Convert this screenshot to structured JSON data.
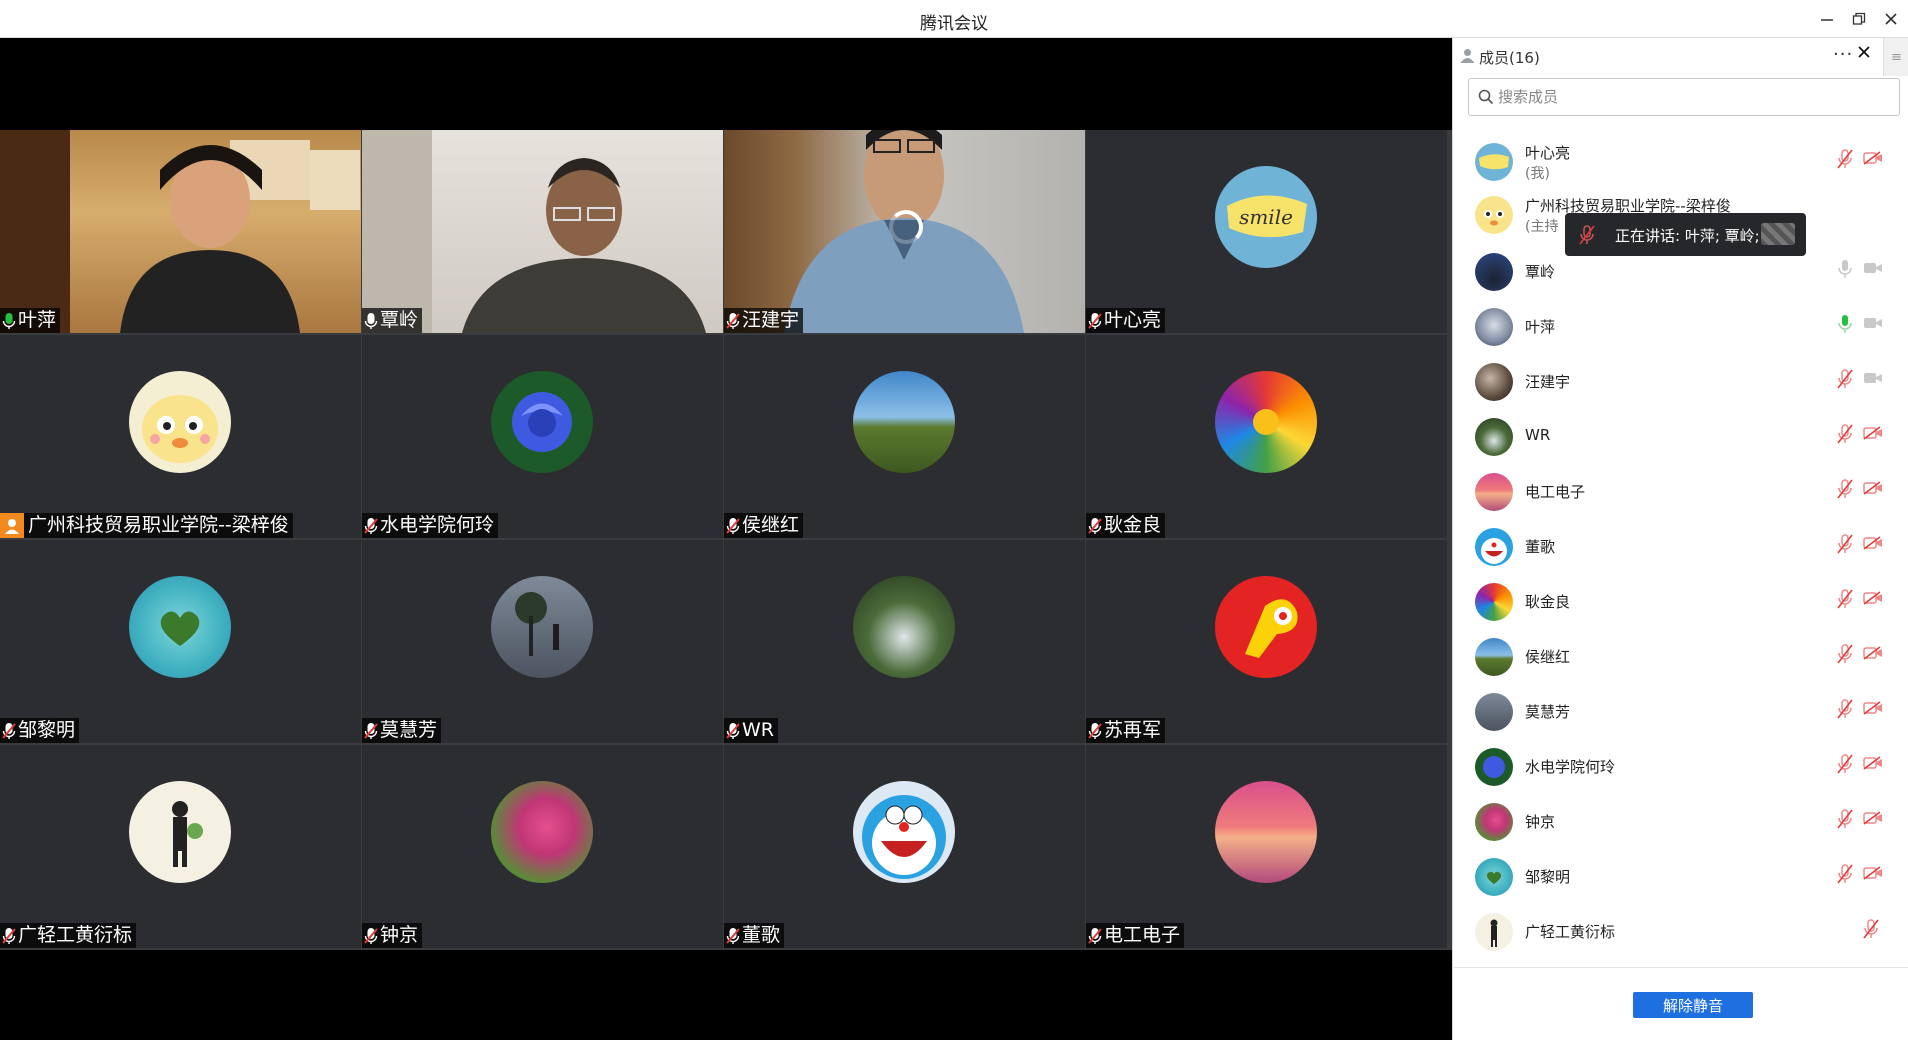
{
  "window": {
    "title": "腾讯会议"
  },
  "tiles": [
    {
      "name": "叶萍",
      "mic": "on"
    },
    {
      "name": "覃岭",
      "mic": "on"
    },
    {
      "name": "汪建宇",
      "mic": "muted"
    },
    {
      "name": "叶心亮",
      "mic": "muted"
    },
    {
      "name": "广州科技贸易职业学院--梁梓俊",
      "mic": "host"
    },
    {
      "name": "水电学院何玲",
      "mic": "muted"
    },
    {
      "name": "侯继红",
      "mic": "muted"
    },
    {
      "name": "耿金良",
      "mic": "muted"
    },
    {
      "name": "邹黎明",
      "mic": "muted"
    },
    {
      "name": "莫慧芳",
      "mic": "muted"
    },
    {
      "name": "WR",
      "mic": "muted"
    },
    {
      "name": "苏再军",
      "mic": "muted"
    },
    {
      "name": "广轻工黄衍标",
      "mic": "muted"
    },
    {
      "name": "钟京",
      "mic": "muted"
    },
    {
      "name": "董歌",
      "mic": "muted"
    },
    {
      "name": "电工电子",
      "mic": "muted"
    }
  ],
  "panel": {
    "title": "成员(16)",
    "search_placeholder": "搜索成员",
    "members": [
      {
        "name": "叶心亮",
        "sub": "(我)"
      },
      {
        "name": "广州科技贸易职业学院--梁梓俊",
        "sub": "(主持"
      },
      {
        "name": "覃岭",
        "sub": ""
      },
      {
        "name": "叶萍",
        "sub": ""
      },
      {
        "name": "汪建宇",
        "sub": ""
      },
      {
        "name": "WR",
        "sub": ""
      },
      {
        "name": "电工电子",
        "sub": ""
      },
      {
        "name": "董歌",
        "sub": ""
      },
      {
        "name": "耿金良",
        "sub": ""
      },
      {
        "name": "侯继红",
        "sub": ""
      },
      {
        "name": "莫慧芳",
        "sub": ""
      },
      {
        "name": "水电学院何玲",
        "sub": ""
      },
      {
        "name": "钟京",
        "sub": ""
      },
      {
        "name": "邹黎明",
        "sub": ""
      },
      {
        "name": "广轻工黄衍标",
        "sub": ""
      }
    ],
    "unmute_label": "解除静音"
  },
  "tooltip": {
    "text": "正在讲话: 叶萍; 覃岭;"
  },
  "colors": {
    "accent": "#1e6fe0",
    "mic_on": "#26c13c",
    "mic_muted": "#e23b3b",
    "host": "#f28a1f"
  }
}
